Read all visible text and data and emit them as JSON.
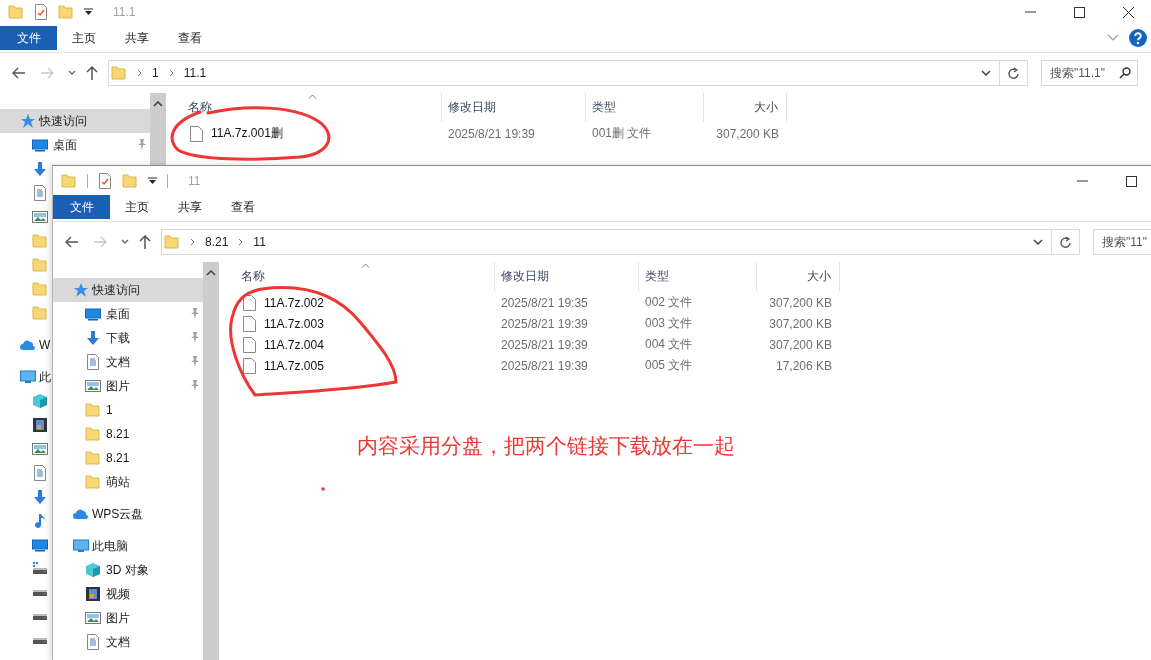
{
  "back_window": {
    "title": "11.1",
    "ribbon_tabs": [
      {
        "label": "文件",
        "selected": true
      },
      {
        "label": "主页",
        "selected": false
      },
      {
        "label": "共享",
        "selected": false
      },
      {
        "label": "查看",
        "selected": false
      }
    ],
    "path": [
      "1",
      "11.1"
    ],
    "search_placeholder": "搜索\"11.1\"",
    "sidebar": [
      {
        "kind": "star",
        "label": "快速访问",
        "selected": true,
        "children": [
          {
            "kind": "desktop",
            "label": "桌面",
            "pinned": true,
            "selected": false
          },
          {
            "kind": "download",
            "selected": false
          },
          {
            "kind": "document",
            "selected": false
          },
          {
            "kind": "picture",
            "selected": false
          },
          {
            "kind": "folder",
            "selected": false
          },
          {
            "kind": "folder",
            "selected": false
          },
          {
            "kind": "folder",
            "selected": false
          },
          {
            "kind": "folder",
            "selected": false
          }
        ]
      },
      {
        "kind": "cloud",
        "label": "W",
        "selected": false
      },
      {
        "kind": "pc",
        "label": "此",
        "selected": false,
        "children": [
          {
            "kind": "cube",
            "selected": false
          },
          {
            "kind": "video",
            "selected": false
          },
          {
            "kind": "picture",
            "selected": false
          },
          {
            "kind": "document",
            "selected": false
          },
          {
            "kind": "download",
            "selected": false
          },
          {
            "kind": "music",
            "selected": false
          },
          {
            "kind": "desktop",
            "selected": false
          },
          {
            "kind": "netdrive",
            "selected": false
          },
          {
            "kind": "drive",
            "selected": false
          },
          {
            "kind": "drive",
            "selected": false
          },
          {
            "kind": "drive",
            "selected": false
          }
        ]
      }
    ],
    "columns": [
      "名称",
      "修改日期",
      "类型",
      "大小"
    ],
    "rows": [
      {
        "name": "11A.7z.001删",
        "date": "2025/8/21 19:39",
        "type": "001删 文件",
        "size": "307,200 KB"
      }
    ]
  },
  "front_window": {
    "title": "11",
    "ribbon_tabs": [
      {
        "label": "文件",
        "selected": true
      },
      {
        "label": "主页",
        "selected": false
      },
      {
        "label": "共享",
        "selected": false
      },
      {
        "label": "查看",
        "selected": false
      }
    ],
    "path": [
      "8.21",
      "11"
    ],
    "search_placeholder": "搜索\"11\"",
    "sidebar": [
      {
        "kind": "star",
        "label": "快速访问",
        "selected": true,
        "children": [
          {
            "kind": "desktop",
            "label": "桌面",
            "pinned": true,
            "selected": false
          },
          {
            "kind": "download",
            "label": "下载",
            "pinned": true,
            "selected": false
          },
          {
            "kind": "document",
            "label": "文档",
            "pinned": true,
            "selected": false
          },
          {
            "kind": "picture",
            "label": "图片",
            "pinned": true,
            "selected": false
          },
          {
            "kind": "folder",
            "label": "1",
            "pinned": false,
            "selected": false
          },
          {
            "kind": "folder",
            "label": "8.21",
            "pinned": false,
            "selected": false
          },
          {
            "kind": "folder",
            "label": "8.21",
            "pinned": false,
            "selected": false
          },
          {
            "kind": "folder",
            "label": "萌站",
            "pinned": false,
            "selected": false
          }
        ]
      },
      {
        "kind": "cloud",
        "label": "WPS云盘",
        "selected": false
      },
      {
        "kind": "pc",
        "label": "此电脑",
        "selected": false,
        "children": [
          {
            "kind": "cube",
            "label": "3D 对象",
            "selected": false
          },
          {
            "kind": "video",
            "label": "视频",
            "selected": false
          },
          {
            "kind": "picture",
            "label": "图片",
            "selected": false
          },
          {
            "kind": "document",
            "label": "文档",
            "selected": false
          }
        ]
      }
    ],
    "columns": [
      "名称",
      "修改日期",
      "类型",
      "大小"
    ],
    "rows": [
      {
        "name": "11A.7z.002",
        "date": "2025/8/21 19:35",
        "type": "002 文件",
        "size": "307,200 KB"
      },
      {
        "name": "11A.7z.003",
        "date": "2025/8/21 19:39",
        "type": "003 文件",
        "size": "307,200 KB"
      },
      {
        "name": "11A.7z.004",
        "date": "2025/8/21 19:39",
        "type": "004 文件",
        "size": "307,200 KB"
      },
      {
        "name": "11A.7z.005",
        "date": "2025/8/21 19:39",
        "type": "005 文件",
        "size": "17,206 KB"
      }
    ]
  },
  "annotation": {
    "note": "内容采用分盘，把两个链接下载放在一起"
  }
}
